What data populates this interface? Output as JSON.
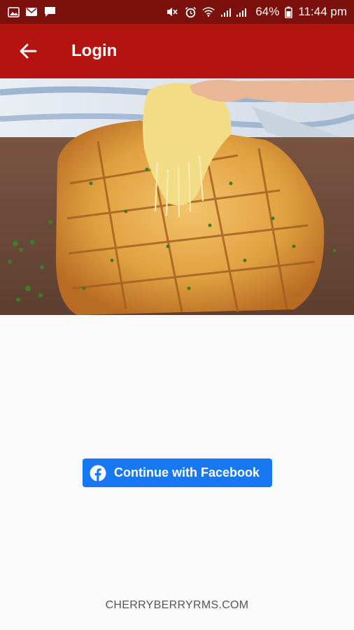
{
  "status_bar": {
    "left_icons": [
      "gallery-icon",
      "mail-icon",
      "chat-icon"
    ],
    "right_icons": [
      "mute-icon",
      "alarm-icon",
      "wifi-icon",
      "signal-icon",
      "battery-icon"
    ],
    "battery_text": "64%",
    "time": "11:44 pm"
  },
  "app_bar": {
    "title": "Login",
    "back_icon": "arrow-left-icon",
    "color": "#b3140f"
  },
  "hero_image": {
    "subject": "cheese-pull-garlic-bread"
  },
  "login": {
    "facebook_label": "Continue with Facebook",
    "facebook_color": "#1877f2"
  },
  "footer": {
    "brand": "CHERRYBERRYRMS.COM"
  }
}
